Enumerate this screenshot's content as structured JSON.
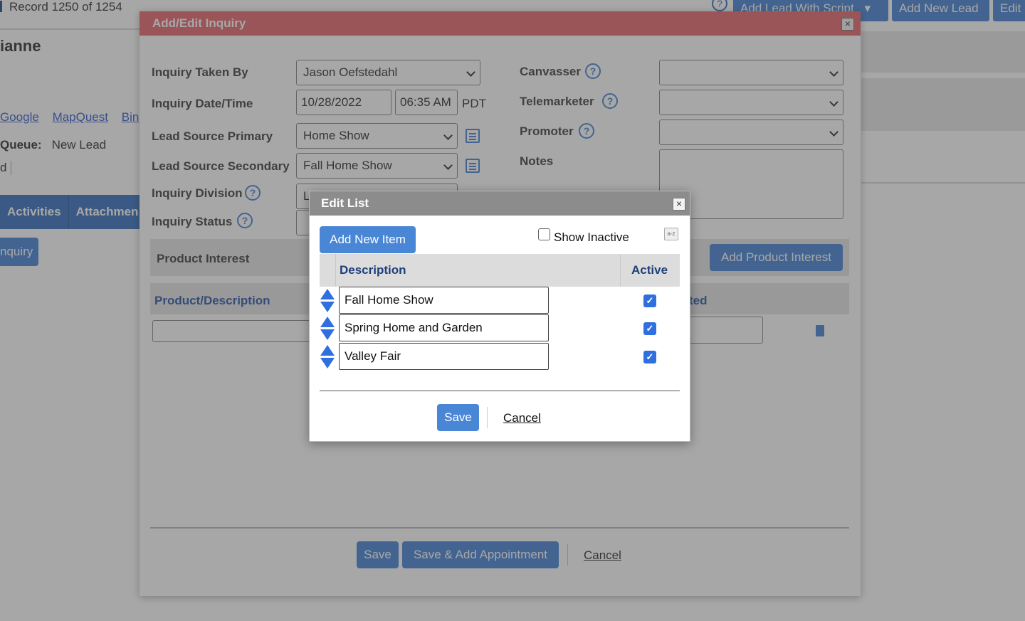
{
  "background": {
    "record_counter": "Record 1250 of 1254",
    "name_partial": "ianne",
    "links": [
      "Google",
      "MapQuest",
      "Bin"
    ],
    "queue_label": "Queue:",
    "queue_value": "New Lead",
    "d_partial": "d",
    "tabs": [
      "Activities",
      "Attachmen"
    ],
    "inquiry_button": "nquiry",
    "help_icon_text": "?",
    "top_buttons": {
      "add_lead_with_script": "Add Lead With Script",
      "dropdown_caret": "▾",
      "add_new_lead": "Add New Lead",
      "edit": "Edit"
    }
  },
  "inquiry_dialog": {
    "title": "Add/Edit Inquiry",
    "close": "×",
    "fields": {
      "taken_by_label": "Inquiry Taken By",
      "taken_by_value": "Jason Oefstedahl",
      "datetime_label": "Inquiry Date/Time",
      "date_value": "10/28/2022",
      "time_value": "06:35 AM",
      "timezone": "PDT",
      "source_primary_label": "Lead Source Primary",
      "source_primary_value": "Home Show",
      "source_secondary_label": "Lead Source Secondary",
      "source_secondary_value": "Fall Home Show",
      "division_label": "Inquiry Division",
      "division_value": "L",
      "status_label": "Inquiry Status",
      "canvasser_label": "Canvasser",
      "canvasser_value": "",
      "telemarketer_label": "Telemarketer",
      "telemarketer_value": "",
      "promoter_label": "Promoter",
      "promoter_value": "",
      "notes_label": "Notes",
      "notes_value": ""
    },
    "product_interest": {
      "section_title": "Product Interest",
      "add_button": "Add Product Interest",
      "col_product": "Product/Description",
      "col_partial": "ted"
    },
    "footer": {
      "save": "Save",
      "save_add_appointment": "Save & Add Appointment",
      "cancel": "Cancel"
    },
    "help_icon_text": "?"
  },
  "edit_list_modal": {
    "title": "Edit List",
    "close": "×",
    "add_new_item": "Add New Item",
    "show_inactive_label": "Show Inactive",
    "show_inactive_checked": false,
    "sort_icon_text": "a-z",
    "col_description": "Description",
    "col_active": "Active",
    "items": [
      {
        "description": "Fall Home Show",
        "active": true
      },
      {
        "description": "Spring Home and Garden",
        "active": true
      },
      {
        "description": "Valley Fair",
        "active": true
      }
    ],
    "check_mark": "✓",
    "save": "Save",
    "cancel": "Cancel"
  },
  "colors": {
    "dialog_title_bg": "#e86b70",
    "modal_title_bg": "#8c8c8c",
    "primary_button": "#4a86d6",
    "checkbox_checked": "#2f6fe0",
    "header_text": "#1f3f7a"
  }
}
